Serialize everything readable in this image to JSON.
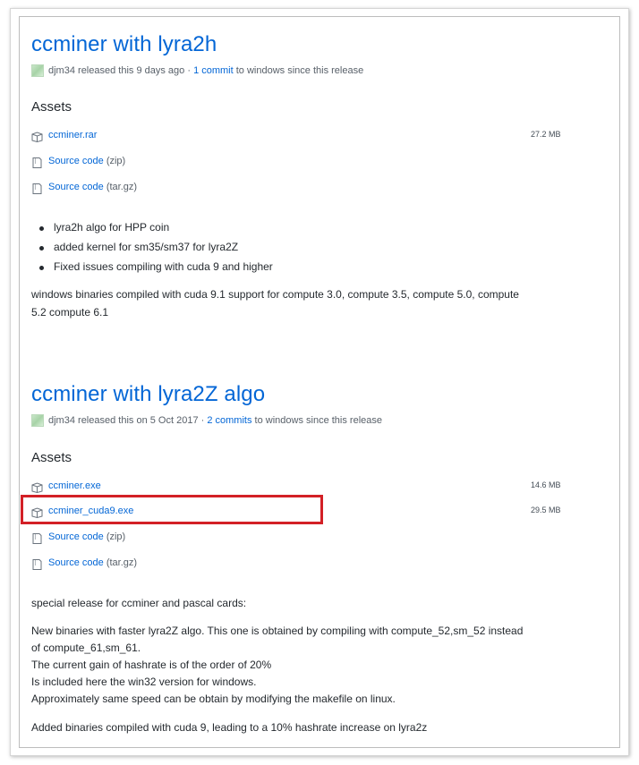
{
  "releases": [
    {
      "title": "ccminer with lyra2h",
      "author": "djm34",
      "released": "released this 9 days ago ·",
      "commits_link": "1 commit",
      "since": "to windows since this release",
      "assets_heading": "Assets",
      "assets": [
        {
          "name": "ccminer.rar",
          "ext": "",
          "size": "27.2 MB"
        },
        {
          "name": "Source code",
          "ext": "(zip)",
          "size": ""
        },
        {
          "name": "Source code",
          "ext": "(tar.gz)",
          "size": ""
        }
      ],
      "bullets": [
        "lyra2h algo for HPP coin",
        "added kernel for sm35/sm37 for lyra2Z",
        "Fixed issues compiling with cuda 9 and higher"
      ],
      "paragraph_lines": [
        "windows binaries compiled with cuda 9.1 support for compute 3.0, compute 3.5, compute 5.0, compute",
        "5.2 compute 6.1"
      ]
    },
    {
      "title": "ccminer with lyra2Z algo",
      "author": "djm34",
      "released": "released this on 5 Oct 2017 ·",
      "commits_link": "2 commits",
      "since": "to windows since this release",
      "assets_heading": "Assets",
      "assets": [
        {
          "name": "ccminer.exe",
          "ext": "",
          "size": "14.6 MB"
        },
        {
          "name": "ccminer_cuda9.exe",
          "ext": "",
          "size": "29.5 MB"
        },
        {
          "name": "Source code",
          "ext": "(zip)",
          "size": ""
        },
        {
          "name": "Source code",
          "ext": "(tar.gz)",
          "size": ""
        }
      ],
      "special": "special release for ccminer and pascal cards:",
      "desc_lines": [
        "New binaries with faster lyra2Z algo. This one is obtained by compiling with compute_52,sm_52 instead",
        "of compute_61,sm_61.",
        "The current gain of hashrate is of the order of 20%",
        "Is included here the win32 version for windows.",
        "Approximately same speed can be obtain by modifying the makefile on linux."
      ],
      "added": "Added binaries compiled with cuda 9, leading to a 10% hashrate increase on lyra2z"
    }
  ],
  "highlight_color": "#d32026",
  "link_color": "#0366d6"
}
